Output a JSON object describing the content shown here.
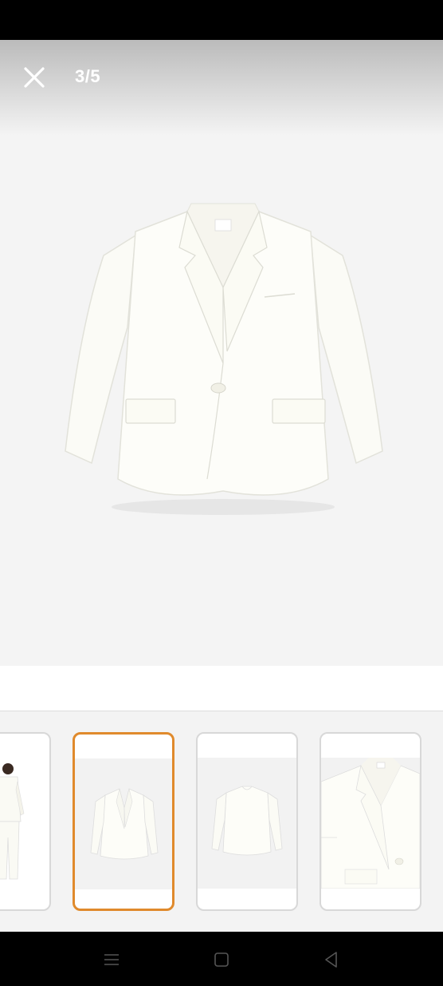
{
  "viewer": {
    "page_indicator": "3/5",
    "close_icon": "close-icon",
    "image": "white-blazer-flat"
  },
  "thumbnails": [
    {
      "image": "model-wearing-white-suit",
      "selected": false
    },
    {
      "image": "white-blazer-flat",
      "selected": true
    },
    {
      "image": "white-blazer-back",
      "selected": false
    },
    {
      "image": "white-blazer-detail",
      "selected": false
    }
  ],
  "colors": {
    "selected_border": "#e08a2c",
    "viewer_bg": "#f4f4f4"
  },
  "navbar": {
    "menu_icon": "menu-icon",
    "home_icon": "home-icon",
    "back_icon": "back-icon"
  }
}
